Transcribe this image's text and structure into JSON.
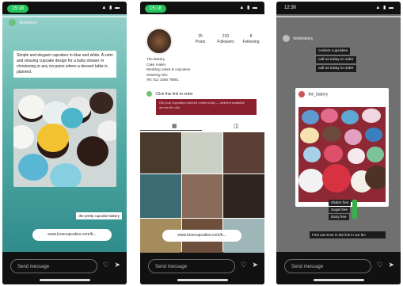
{
  "phone1": {
    "status": {
      "time": "15:18",
      "icons": "▲ ▮ ▬"
    },
    "story": {
      "username": "lambakery",
      "caption": "Simple and elegant cupcakes in blue and white. A calm and relaxing cupcake design for a baby shower or christening or any occasion where a dessert table is planned.",
      "tag": "the pretty cupcake bakery",
      "link": "www.lovecupcakes.com/b..."
    },
    "bottom": {
      "message_placeholder": "Send message"
    }
  },
  "phone2": {
    "status": {
      "time": "15:18",
      "icons": "▲ ▮ ▬"
    },
    "profile": {
      "posts_count": "25",
      "posts_label": "Posts",
      "followers_count": "210",
      "followers_label": "Followers",
      "following_count": "8",
      "following_label": "Following",
      "bio_lines": [
        "The Bakery",
        "Cake maker",
        "Wedding cakes & cupcakes",
        "Ordering info:",
        "Tel: 012 3456 78901"
      ],
      "highlight_label": "Click this link to order",
      "banner_text": "Get your cupcakes ordered online today — delivery available across the city."
    },
    "link_button": "www.lovecupcakes.com/b...",
    "bottom": {
      "message_placeholder": "Send message"
    }
  },
  "phone3": {
    "status": {
      "time": "12:30",
      "icons": "▲ ▮ ▬"
    },
    "story": {
      "username": "tortebakery",
      "highlights": [
        "custom cupcakes",
        "call us today to order",
        "call us today to order"
      ],
      "card_username": "the_bakery",
      "options": [
        "Gluten free",
        "Sugar free",
        "Dairy free"
      ],
      "caption": "Find out more in the link in our bio"
    },
    "bottom": {
      "message_placeholder": "Send message"
    }
  }
}
